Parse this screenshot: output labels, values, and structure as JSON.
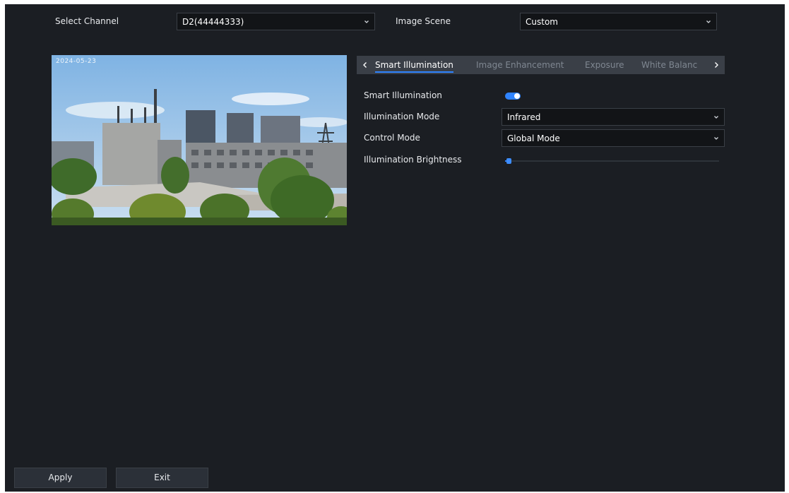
{
  "header": {
    "select_channel_label": "Select Channel",
    "channel_value": "D2(44444333)",
    "image_scene_label": "Image Scene",
    "image_scene_value": "Custom"
  },
  "preview": {
    "osd_text": "2024-05-23"
  },
  "tabs": [
    {
      "label": "Smart Illumination",
      "active": true
    },
    {
      "label": "Image Enhancement",
      "active": false
    },
    {
      "label": "Exposure",
      "active": false
    },
    {
      "label": "White Balanc",
      "active": false
    }
  ],
  "settings": {
    "smart_illumination_label": "Smart Illumination",
    "smart_illumination_on": true,
    "illumination_mode_label": "Illumination Mode",
    "illumination_mode_value": "Infrared",
    "control_mode_label": "Control Mode",
    "control_mode_value": "Global Mode",
    "brightness_label": "Illumination Brightness",
    "brightness_level": 0.01
  },
  "buttons": {
    "apply": "Apply",
    "exit": "Exit"
  },
  "colors": {
    "background": "#1b1e23",
    "accent": "#2f84ff",
    "tabbar": "#3a3f47",
    "input_bg": "#121417"
  }
}
